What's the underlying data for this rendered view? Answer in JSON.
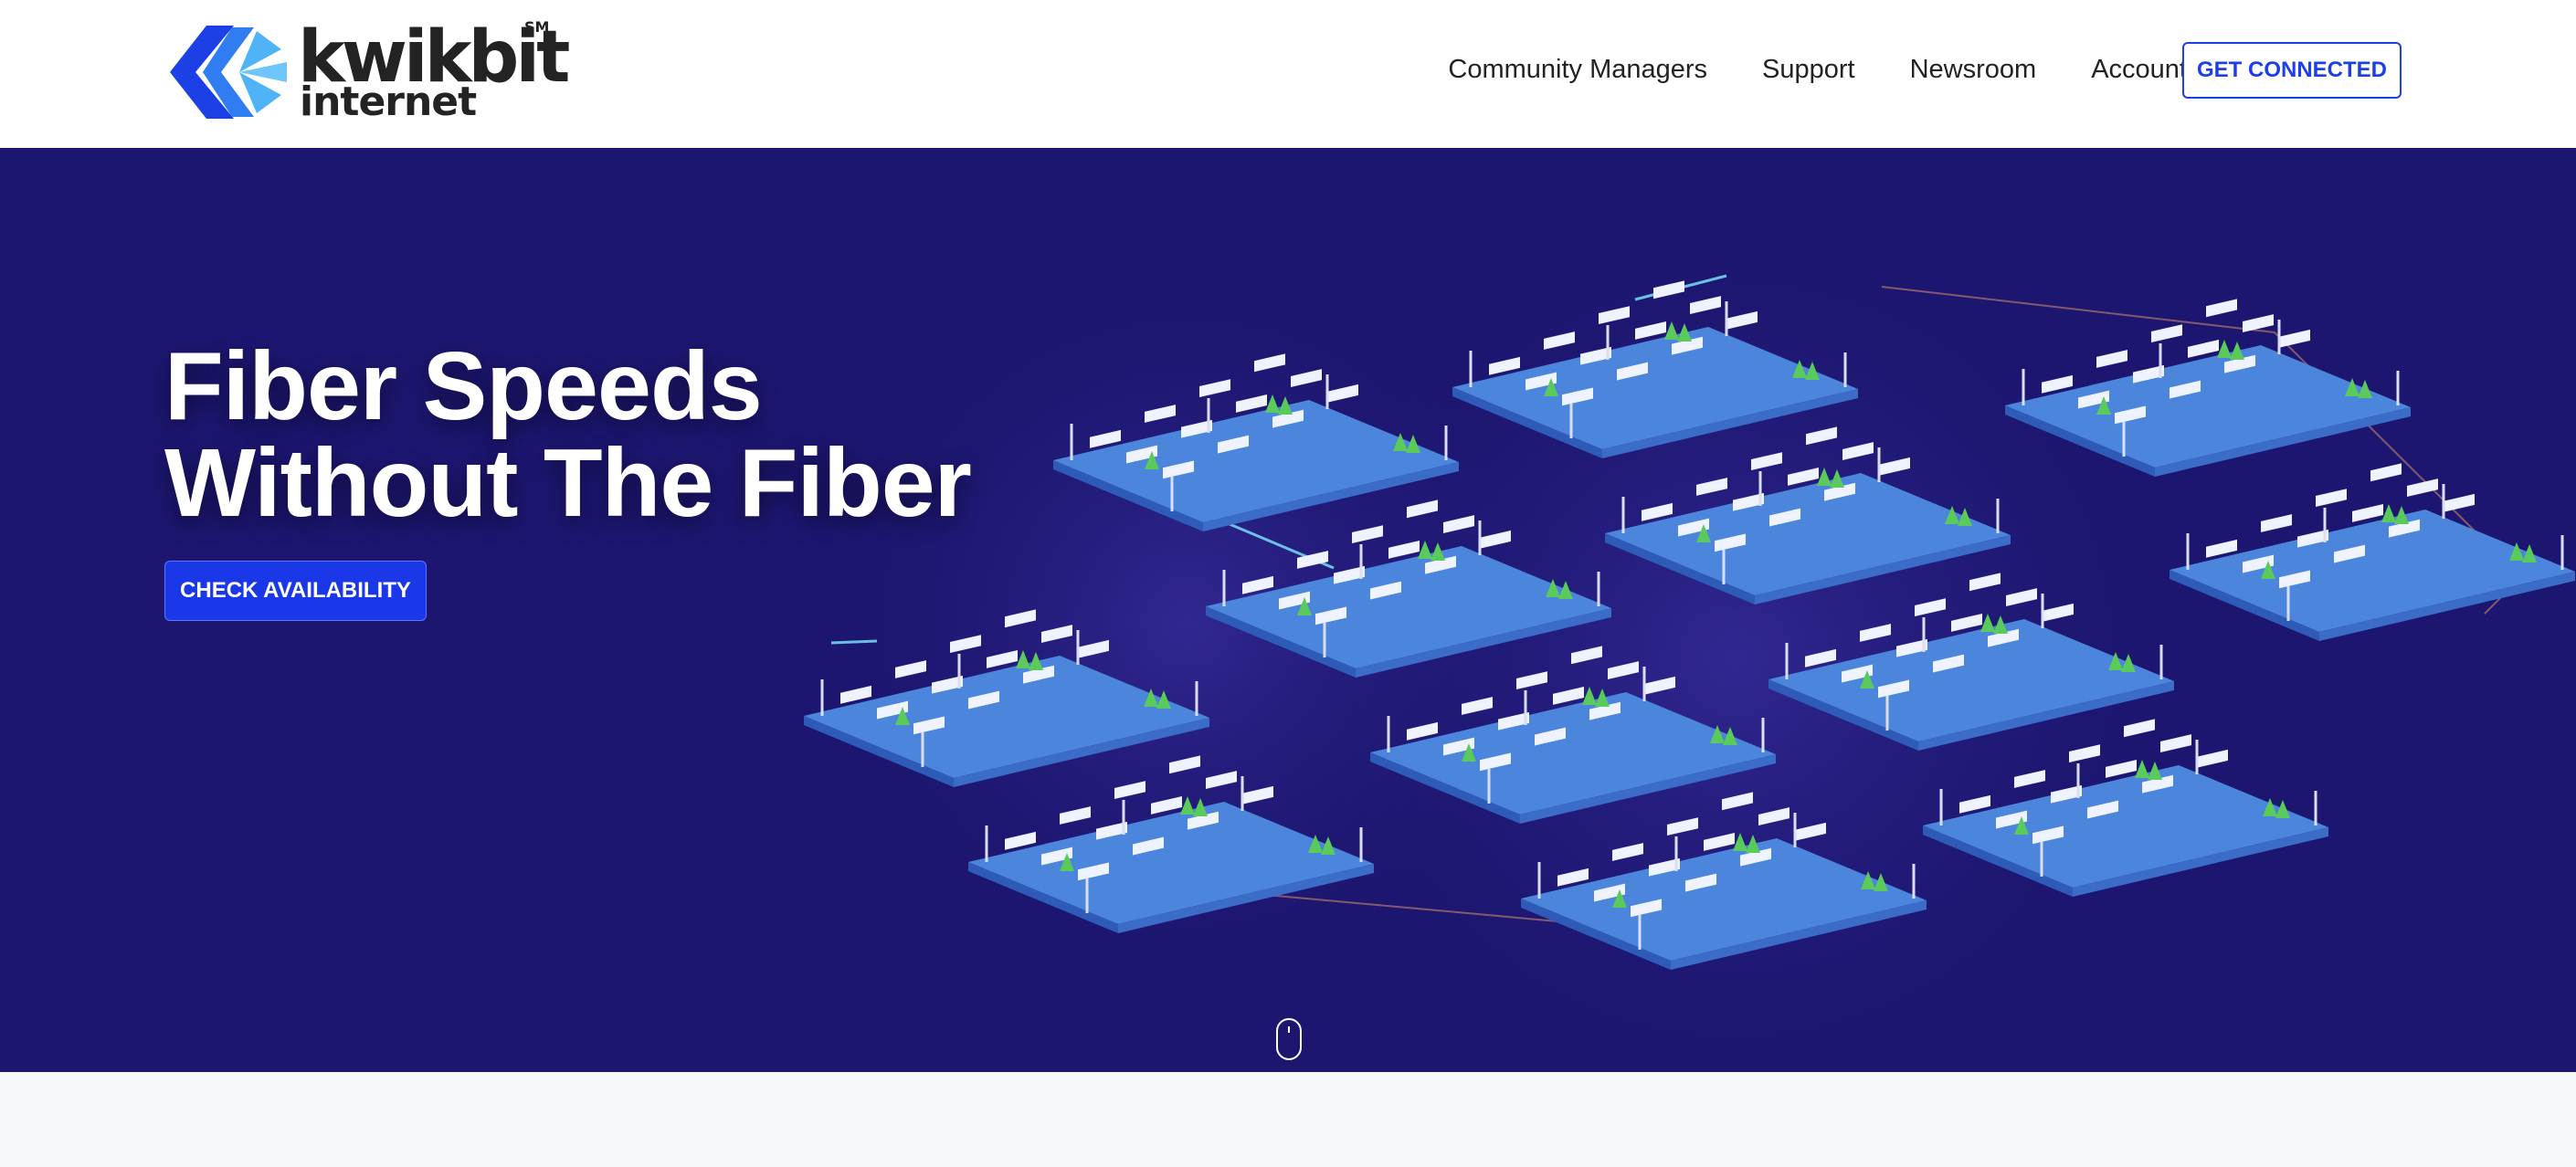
{
  "brand": {
    "name": "kwikbit",
    "sub": "internet",
    "mark": "SM",
    "colors": {
      "dark": "#232323",
      "blue": "#1d3fe6",
      "light_blue": "#4fb3f7"
    }
  },
  "nav": {
    "items": [
      "Community Managers",
      "Support",
      "Newsroom",
      "Account"
    ],
    "cta": "GET CONNECTED"
  },
  "hero": {
    "headline_line1": "Fiber Speeds",
    "headline_line2": "Without The Fiber",
    "button": "CHECK AVAILABILITY",
    "background": "#1c1670",
    "scroll_icon": "mouse-scroll-icon",
    "illustration": "isometric-neighborhood-network"
  }
}
